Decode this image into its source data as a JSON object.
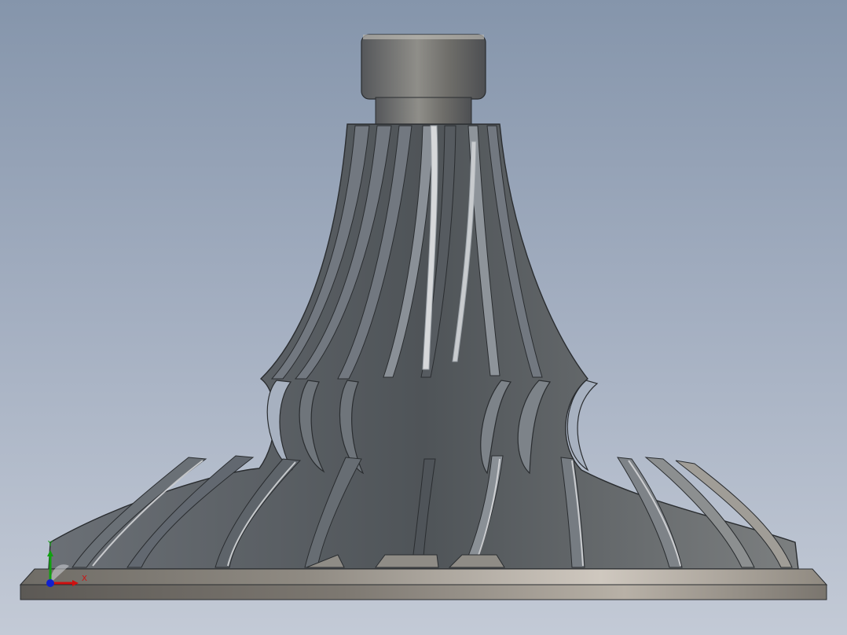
{
  "viewport": {
    "background_top": "#8595ab",
    "background_bottom": "#c3cad6"
  },
  "model": {
    "part": "impeller-on-base-plate",
    "body_color": "#5b6066",
    "blade_color": "#6c7177",
    "edge_color": "#2a2d30",
    "highlight_color": "#d6d8da",
    "base_color": "#aaa59d"
  },
  "triad": {
    "x_label": "X",
    "y_label": "Y",
    "x_color": "#d01010",
    "y_color": "#10a010",
    "z_color": "#1020d0"
  }
}
